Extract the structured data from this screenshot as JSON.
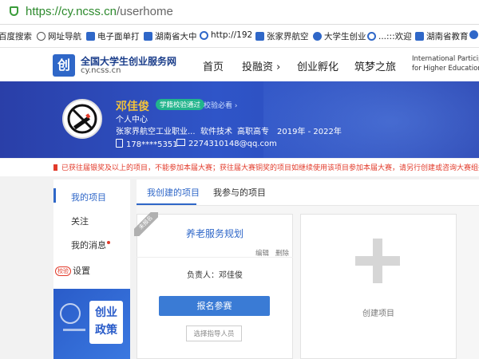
{
  "address_bar": {
    "scheme": "https://",
    "host": "cy.ncss.cn",
    "path": "/userhome"
  },
  "bookmarks": [
    {
      "label": "百度搜索",
      "icon": "baidu-icon",
      "color": "#2f67c8"
    },
    {
      "label": "网址导航",
      "icon": "globe-icon",
      "color": "#555555"
    },
    {
      "label": "电子面单打",
      "icon": "app-icon",
      "color": "#2f67c8"
    },
    {
      "label": "湖南省大中",
      "icon": "doc-icon",
      "color": "#2f67c8"
    },
    {
      "label": "http://192",
      "icon": "link-icon",
      "color": "#2f67c8"
    },
    {
      "label": "张家界航空",
      "icon": "doc-icon",
      "color": "#2f67c8"
    },
    {
      "label": "大学生创业",
      "icon": "paw-icon",
      "color": "#2f67c8"
    },
    {
      "label": "...:::欢迎",
      "icon": "link-icon",
      "color": "#2f67c8"
    },
    {
      "label": "湖南省教育",
      "icon": "doc-icon",
      "color": "#2f67c8"
    },
    {
      "label": "",
      "icon": "paw-icon",
      "color": "#2f67c8"
    }
  ],
  "header": {
    "logo_text": "创",
    "brand": "全国大学生创业服务网",
    "domain": "cy.ncss.cn",
    "nav": [
      "首页",
      "投融资 ›",
      "创业孵化",
      "筑梦之旅"
    ],
    "intl_line1": "International Participant",
    "intl_line2": "for Higher Education"
  },
  "profile": {
    "name": "邓佳俊",
    "badge": "学籍校验通过",
    "verify_link": "校验必看 ›",
    "center": "个人中心",
    "school": "张家界航空工业职业...",
    "major": "软件技术",
    "level": "高职高专",
    "years": "2019年 - 2022年",
    "phone": "178****5351",
    "email": "2274310148@qq.com"
  },
  "notice": "已获往届银奖及以上的项目，不能参加本届大赛；获往届大赛铜奖的项目如继续使用该项目参加本届大赛，请另行创建或咨询大赛组委会。",
  "sidebar": {
    "items": [
      "我的项目",
      "关注",
      "我的消息",
      "设置"
    ],
    "settings_tag": "校验",
    "promo_line1": "创业",
    "promo_line2": "政策"
  },
  "tabs": [
    "我创建的项目",
    "我参与的项目"
  ],
  "project_card": {
    "ribbon": "未报名",
    "name": "养老服务规划",
    "edit": "编辑",
    "delete": "删除",
    "leader": "负责人：邓佳俊",
    "signup": "报名参赛",
    "mentor": "选择指导人员"
  },
  "create_card": {
    "label": "创建项目"
  },
  "colors": {
    "brand_blue": "#2f67c8",
    "banner": "#2a44b0",
    "alert_red": "#e23a2a",
    "badge_green": "#22b48c",
    "name_gold": "#f2c23a"
  }
}
